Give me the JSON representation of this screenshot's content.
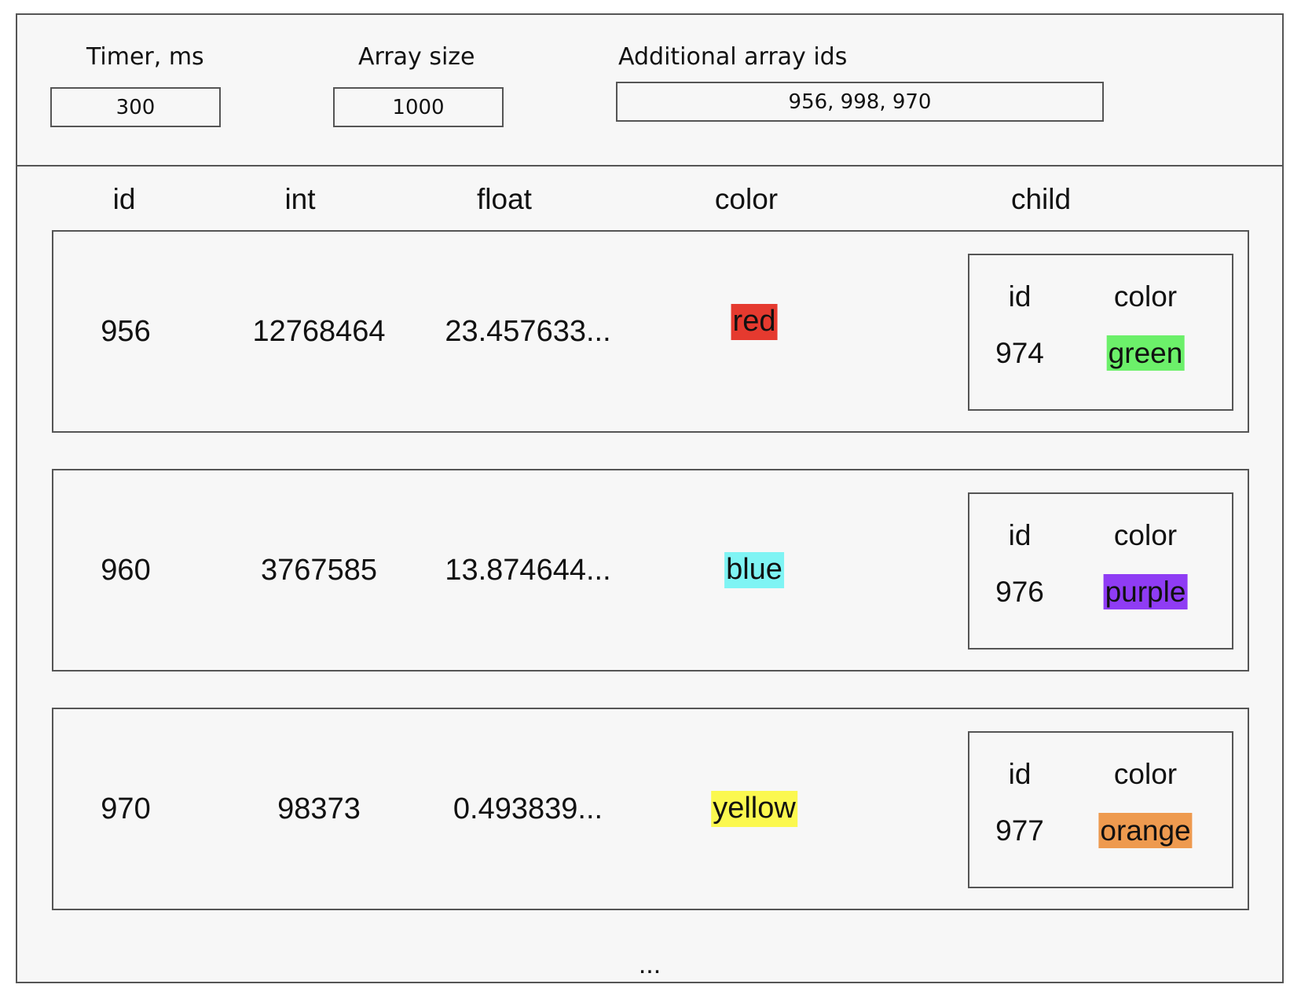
{
  "controls": {
    "timer_label": "Timer, ms",
    "timer_value": "300",
    "array_size_label": "Array size",
    "array_size_value": "1000",
    "additional_ids_label": "Additional array ids",
    "additional_ids_value": "956, 998, 970"
  },
  "table": {
    "headers": {
      "id": "id",
      "int": "int",
      "float": "float",
      "color": "color",
      "child": "child"
    },
    "rows": [
      {
        "id": "956",
        "int": "12768464",
        "float": "23.457633...",
        "color": "red",
        "color_hex": "#e53a2f",
        "child": {
          "id_label": "id",
          "color_label": "color",
          "id": "974",
          "color": "green",
          "color_hex": "#6cf06a"
        }
      },
      {
        "id": "960",
        "int": "3767585",
        "float": "13.874644...",
        "color": "blue",
        "color_hex": "#7ff4f4",
        "child": {
          "id_label": "id",
          "color_label": "color",
          "id": "976",
          "color": "purple",
          "color_hex": "#8f3cf4"
        }
      },
      {
        "id": "970",
        "int": "98373",
        "float": "0.493839...",
        "color": "yellow",
        "color_hex": "#fbf84f",
        "child": {
          "id_label": "id",
          "color_label": "color",
          "id": "977",
          "color": "orange",
          "color_hex": "#ee9a4f"
        }
      }
    ],
    "more": "..."
  }
}
